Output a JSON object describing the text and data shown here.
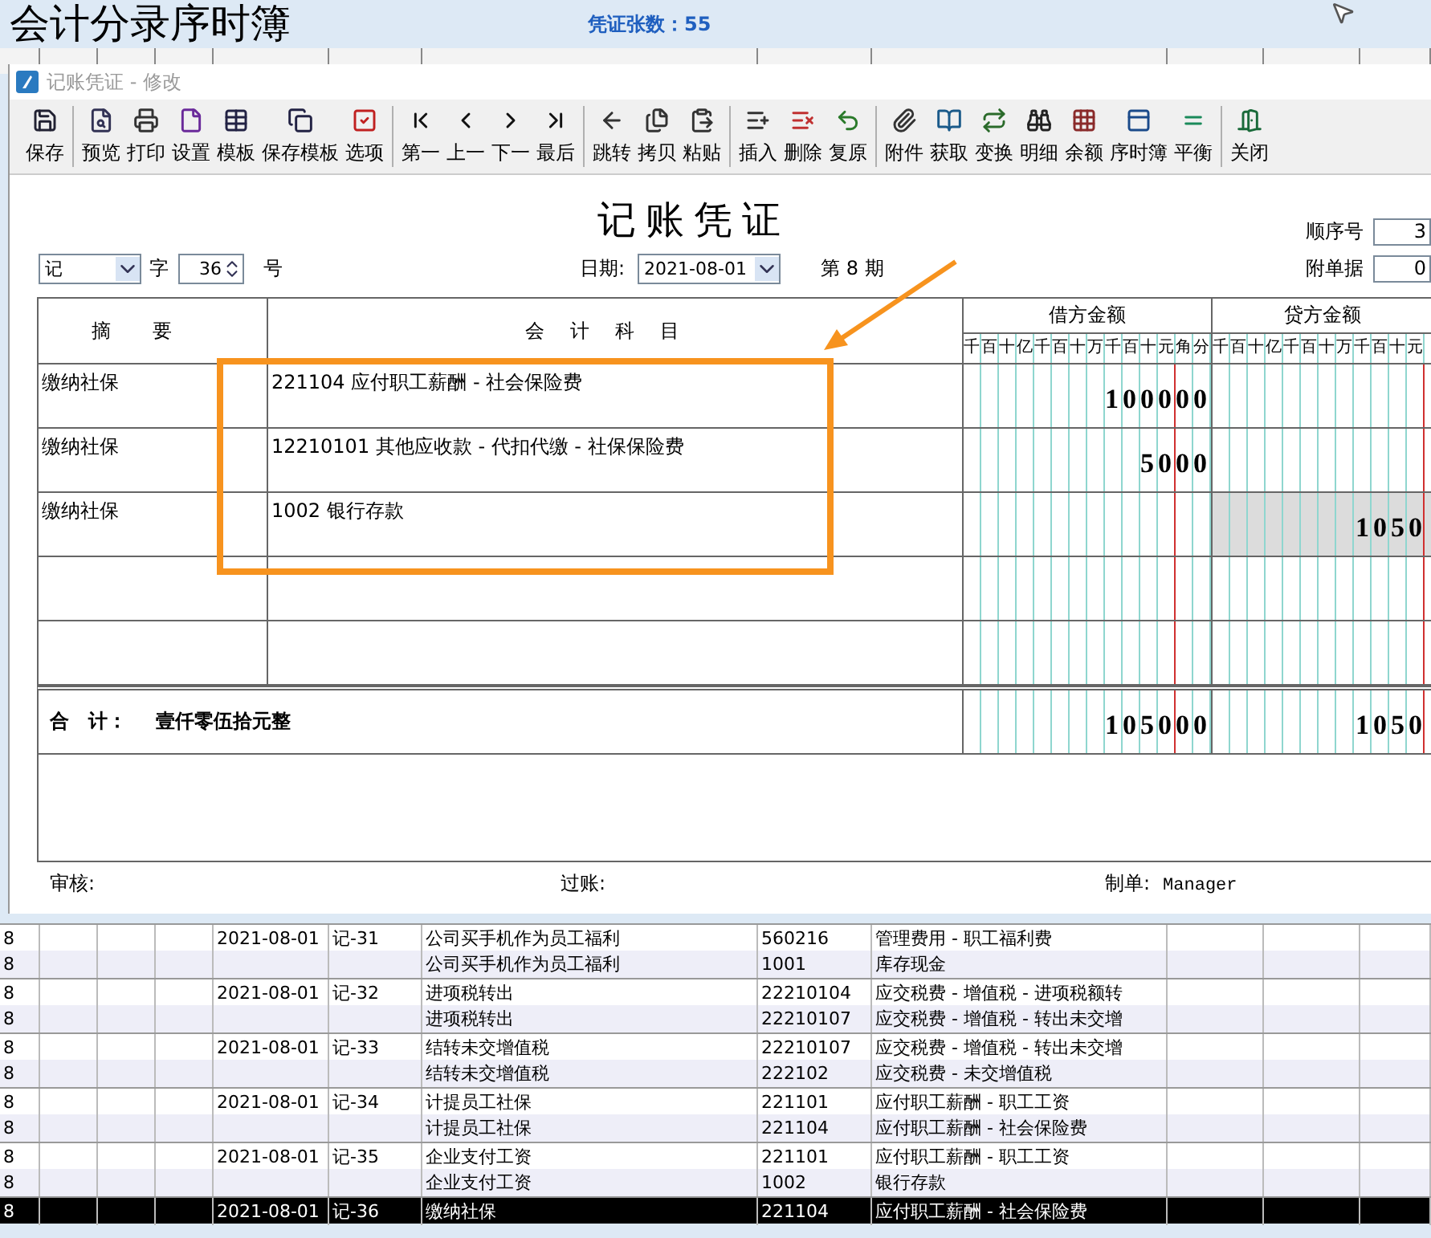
{
  "window": {
    "title": "会计分录序时簿",
    "voucher_count": "凭证张数：55"
  },
  "list": {
    "rows": [
      {
        "period": "8",
        "date": "2021-08-01",
        "voucher": "记-31",
        "summary": "公司买手机作为员工福利",
        "code": "560216",
        "account": "管理费用 - 职工福利费",
        "selected": false
      },
      {
        "period": "8",
        "summary": "公司买手机作为员工福利",
        "code": "1001",
        "account": "库存现金",
        "selected": false
      },
      {
        "period": "8",
        "date": "2021-08-01",
        "voucher": "记-32",
        "summary": "进项税转出",
        "code": "22210104",
        "account": "应交税费 - 增值税 - 进项税额转",
        "selected": false
      },
      {
        "period": "8",
        "summary": "进项税转出",
        "code": "22210107",
        "account": "应交税费 - 增值税 - 转出未交增",
        "selected": false
      },
      {
        "period": "8",
        "date": "2021-08-01",
        "voucher": "记-33",
        "summary": "结转未交增值税",
        "code": "22210107",
        "account": "应交税费 - 增值税 - 转出未交增",
        "selected": false
      },
      {
        "period": "8",
        "summary": "结转未交增值税",
        "code": "222102",
        "account": "应交税费 - 未交增值税",
        "selected": false
      },
      {
        "period": "8",
        "date": "2021-08-01",
        "voucher": "记-34",
        "summary": "计提员工社保",
        "code": "221101",
        "account": "应付职工薪酬 - 职工工资",
        "selected": false
      },
      {
        "period": "8",
        "summary": "计提员工社保",
        "code": "221104",
        "account": "应付职工薪酬 - 社会保险费",
        "selected": false
      },
      {
        "period": "8",
        "date": "2021-08-01",
        "voucher": "记-35",
        "summary": "企业支付工资",
        "code": "221101",
        "account": "应付职工薪酬 - 职工工资",
        "selected": false
      },
      {
        "period": "8",
        "summary": "企业支付工资",
        "code": "1002",
        "account": "银行存款",
        "selected": false
      },
      {
        "period": "8",
        "date": "2021-08-01",
        "voucher": "记-36",
        "summary": "缴纳社保",
        "code": "221104",
        "account": "应付职工薪酬 - 社会保险费",
        "selected": true
      }
    ]
  },
  "dialog": {
    "title": "记账凭证 - 修改",
    "toolbar": [
      [
        "保存"
      ],
      [
        "预览",
        "打印",
        "设置",
        "模板",
        "保存模板",
        "选项"
      ],
      [
        "第一",
        "上一",
        "下一",
        "最后"
      ],
      [
        "跳转",
        "拷贝",
        "粘贴"
      ],
      [
        "插入",
        "删除",
        "复原"
      ],
      [
        "附件",
        "获取",
        "变换",
        "明细",
        "余额",
        "序时簿",
        "平衡"
      ],
      [
        "关闭"
      ]
    ],
    "voucher": {
      "title": "记账凭证",
      "word": "记",
      "word_label": "字",
      "number": "36",
      "number_suffix": "号",
      "date_label": "日期:",
      "date": "2021-08-01",
      "period": "第 8 期",
      "seq_label": "顺序号",
      "seq": "3",
      "attach_label": "附单据",
      "attach": "0",
      "summary_header": "摘要",
      "account_header": "会计科目",
      "debit_header": "借方金额",
      "credit_header": "贷方金额",
      "debit_digits": [
        "千",
        "百",
        "十",
        "亿",
        "千",
        "百",
        "十",
        "万",
        "千",
        "百",
        "十",
        "元",
        "角",
        "分"
      ],
      "credit_digits": [
        "千",
        "百",
        "十",
        "亿",
        "千",
        "百",
        "十",
        "万",
        "千",
        "百",
        "十",
        "元"
      ],
      "entries": [
        {
          "summary": "缴纳社保",
          "account": "221104 应付职工薪酬 - 社会保险费",
          "debit": "100000",
          "credit_selected": false
        },
        {
          "summary": "缴纳社保",
          "account": "12210101 其他应收款 - 代扣代缴 - 社保保险费",
          "debit": "5000",
          "credit_selected": false
        },
        {
          "summary": "缴纳社保",
          "account": "1002 银行存款",
          "credit": "1050",
          "credit_selected": true
        }
      ],
      "total_label": "合　计：",
      "total_words": "壹仟零伍拾元整",
      "total_debit": "105000",
      "total_credit": "1050",
      "review_label": "审核:",
      "posting_label": "过账:",
      "maker_label": "制单:",
      "maker": "Manager"
    }
  }
}
